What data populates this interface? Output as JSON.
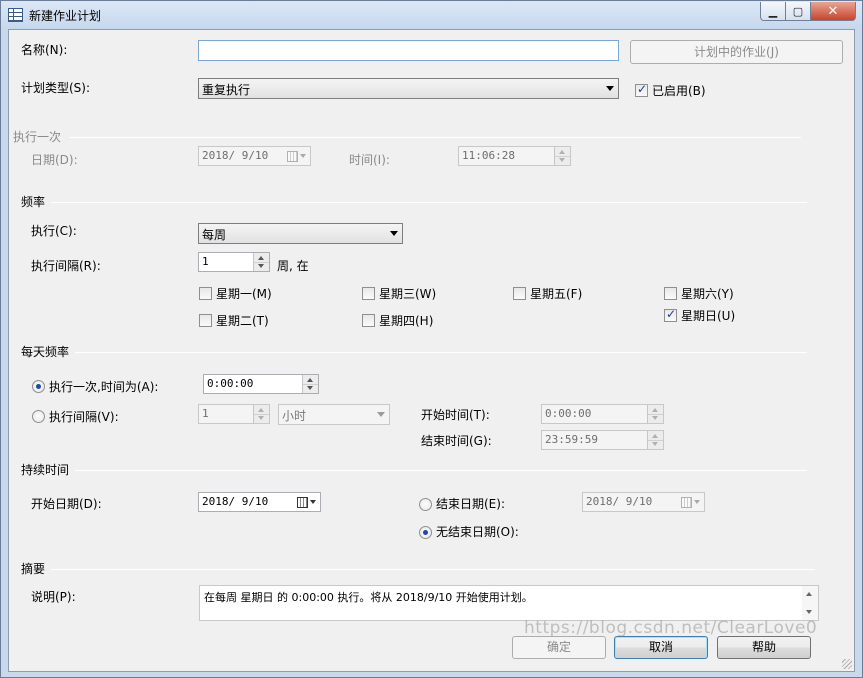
{
  "window": {
    "title": "新建作业计划",
    "colors": {
      "titlebar": "#c6d8ee",
      "close": "#c8442c",
      "client": "#f0f0f0"
    }
  },
  "name": {
    "label": "名称(N):",
    "value": "",
    "jobs_button": "计划中的作业(J)"
  },
  "schedule_type": {
    "label": "计划类型(S):",
    "value": "重复执行",
    "enabled_label": "已启用(B)",
    "enabled_checked": true
  },
  "once": {
    "group": "执行一次",
    "date_label": "日期(D):",
    "date_value": "2018/ 9/10",
    "time_label": "时间(I):",
    "time_value": "11:06:28"
  },
  "frequency": {
    "group": "频率",
    "occurs_label": "执行(C):",
    "occurs_value": "每周",
    "interval_label": "执行间隔(R):",
    "interval_value": "1",
    "interval_unit": "周, 在",
    "days": [
      {
        "label": "星期一(M)",
        "checked": false
      },
      {
        "label": "星期三(W)",
        "checked": false
      },
      {
        "label": "星期五(F)",
        "checked": false
      },
      {
        "label": "星期六(Y)",
        "checked": false
      },
      {
        "label": "星期二(T)",
        "checked": false
      },
      {
        "label": "星期四(H)",
        "checked": false
      },
      {
        "label": "星期日(U)",
        "checked": true
      }
    ]
  },
  "daily": {
    "group": "每天频率",
    "once_label": "执行一次,时间为(A):",
    "once_value": "0:00:00",
    "once_checked": true,
    "every_label": "执行间隔(V):",
    "every_value": "1",
    "every_unit": "小时",
    "every_checked": false,
    "start_label": "开始时间(T):",
    "start_value": "0:00:00",
    "end_label": "结束时间(G):",
    "end_value": "23:59:59"
  },
  "duration": {
    "group": "持续时间",
    "start_label": "开始日期(D):",
    "start_value": "2018/ 9/10",
    "end_label": "结束日期(E):",
    "end_value": "2018/ 9/10",
    "end_checked": false,
    "no_end_label": "无结束日期(O):",
    "no_end_checked": true
  },
  "summary": {
    "group": "摘要",
    "desc_label": "说明(P):",
    "desc_value": "在每周 星期日 的 0:00:00 执行。将从 2018/9/10 开始使用计划。"
  },
  "buttons": {
    "ok": "确定",
    "cancel": "取消",
    "help": "帮助"
  },
  "watermark": "https://blog.csdn.net/ClearLove0"
}
